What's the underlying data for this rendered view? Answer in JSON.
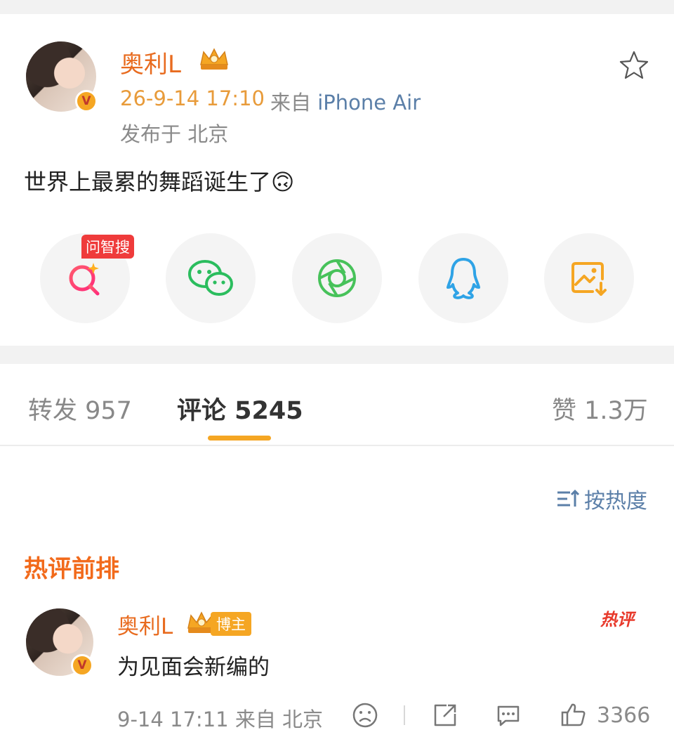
{
  "post": {
    "author": "奥利L",
    "timestamp": "26-9-14 17:10",
    "from_prefix": "来自",
    "device": "iPhone Air",
    "location": "发布于 北京",
    "text": "世界上最累的舞蹈诞生了🙃"
  },
  "share": {
    "tag": "问智搜",
    "buttons": [
      "smart-search",
      "wechat",
      "moments",
      "qq",
      "save-image"
    ]
  },
  "tabs": {
    "repost": "转发 957",
    "comments": "评论 5245",
    "likes": "赞 1.3万"
  },
  "sort": {
    "label": "按热度"
  },
  "section": {
    "title": "热评前排"
  },
  "comment": {
    "author": "奥利L",
    "owner_tag": "博主",
    "hot_tag": "热评",
    "text": "为见面会新编的",
    "meta": "9-14 17:11 来自 北京",
    "like_count": "3366"
  },
  "colors": {
    "accent": "#e86b1f",
    "gold": "#f5a623",
    "link": "#5b7fa8",
    "hot": "#e8392b"
  }
}
